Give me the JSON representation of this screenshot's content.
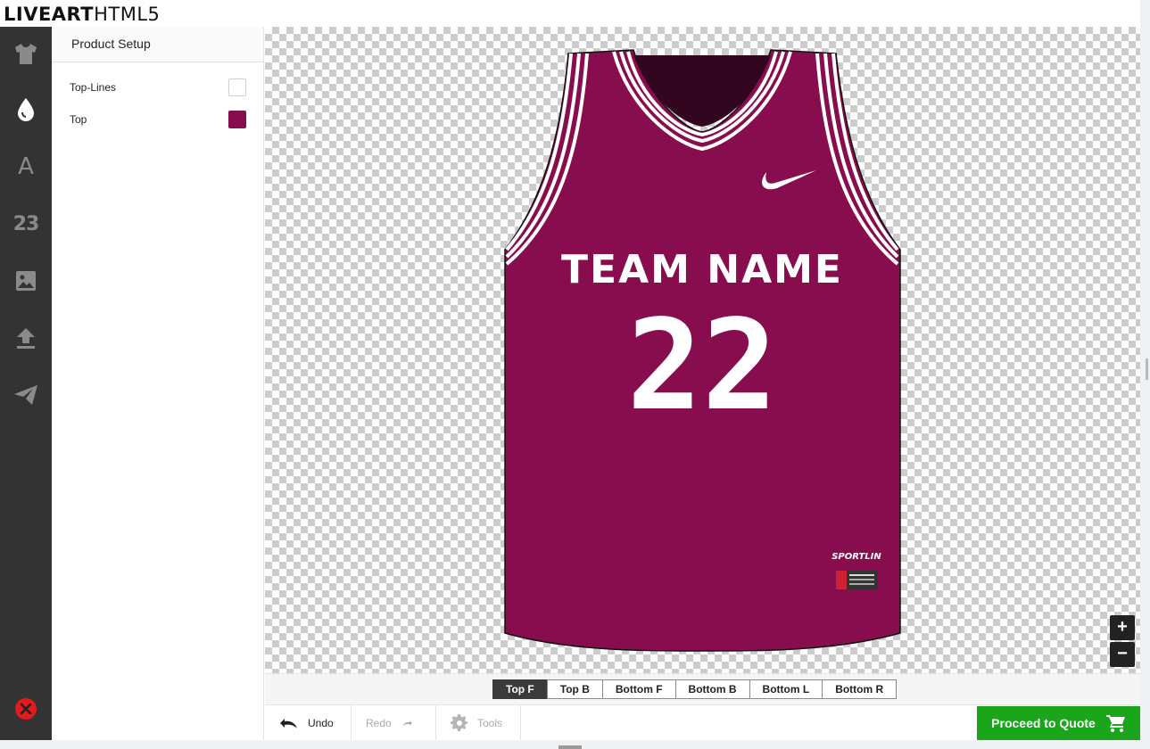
{
  "header": {
    "brand_bold": "LIVEART",
    "brand_thin": "HTML5"
  },
  "rail": {
    "items": [
      {
        "name": "product-icon",
        "active": false
      },
      {
        "name": "colors-icon",
        "active": true
      },
      {
        "name": "text-icon",
        "glyph": "A",
        "active": false
      },
      {
        "name": "numbers-icon",
        "glyph": "23",
        "active": false
      },
      {
        "name": "image-icon",
        "active": false
      },
      {
        "name": "upload-icon",
        "active": false
      },
      {
        "name": "send-icon",
        "active": false
      }
    ],
    "close_icon": "close-icon"
  },
  "panel": {
    "title": "Product Setup",
    "swatches": [
      {
        "label": "Top-Lines",
        "color": "#ffffff"
      },
      {
        "label": "Top",
        "color": "#880d4e"
      }
    ]
  },
  "jersey": {
    "body_color": "#880d4e",
    "collar_inner_color": "#33061f",
    "stripe_color": "#ffffff",
    "team_name": "TEAM NAME",
    "number": "22",
    "label_brand": "SPORTLIN"
  },
  "zoom": {
    "in": "+",
    "out": "−"
  },
  "tabs": [
    {
      "label": "Top F",
      "active": true
    },
    {
      "label": "Top B",
      "active": false
    },
    {
      "label": "Bottom F",
      "active": false
    },
    {
      "label": "Bottom B",
      "active": false
    },
    {
      "label": "Bottom L",
      "active": false
    },
    {
      "label": "Bottom R",
      "active": false
    }
  ],
  "toolbar": {
    "undo": "Undo",
    "redo": "Redo",
    "tools": "Tools",
    "quote": "Proceed to Quote"
  }
}
